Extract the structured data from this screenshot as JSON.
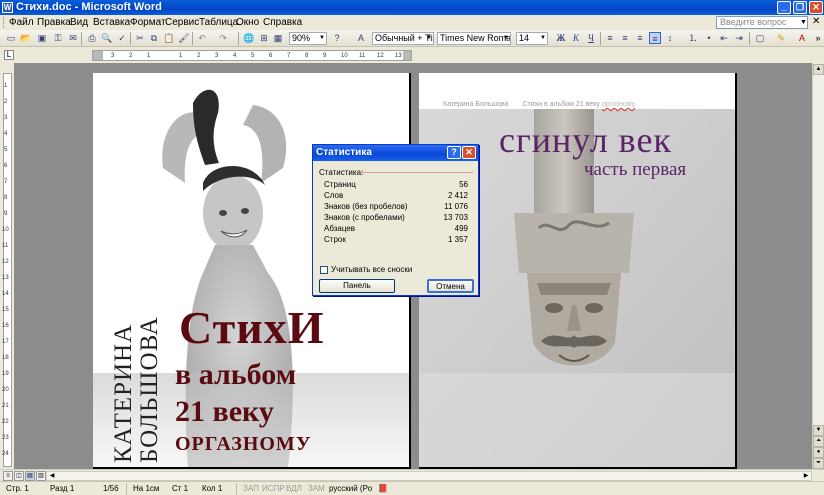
{
  "window": {
    "title": "Стихи.doc - Microsoft Word"
  },
  "menu": {
    "items": [
      "Файл",
      "Правка",
      "Вид",
      "Вставка",
      "Формат",
      "Сервис",
      "Таблица",
      "Окно",
      "Справка"
    ],
    "help_placeholder": "Введите вопрос"
  },
  "toolbar": {
    "zoom": "90%",
    "style": "Обычный + Tim",
    "font": "Times New Roman",
    "size": "14"
  },
  "ruler": {
    "h_numbers": [
      "3",
      "2",
      "1",
      "1",
      "2",
      "3",
      "4",
      "5",
      "6",
      "7",
      "8",
      "9",
      "10",
      "11",
      "12",
      "13"
    ],
    "v_numbers": [
      "1",
      "2",
      "3",
      "4",
      "5",
      "6",
      "7",
      "8",
      "9",
      "10",
      "11",
      "12",
      "13",
      "14",
      "15",
      "16",
      "17",
      "18",
      "19",
      "20",
      "21",
      "22",
      "23",
      "24"
    ]
  },
  "left_page": {
    "title_line1": "СтихИ",
    "title_line2": "в альбом",
    "title_line3": "21 веку",
    "title_line4": "ОРГАЗНОМУ",
    "author_line1": "КАТЕРИНА",
    "author_line2": "БОЛЬШОВА"
  },
  "right_page": {
    "header_author": "Катерина Большова",
    "header_title_start": "Стихи в альбом 21 веку ",
    "header_title_end": "оргазному",
    "title": "сгинул век",
    "subtitle": "часть первая"
  },
  "dialog": {
    "title": "Статистика",
    "group_label": "Статистика:",
    "rows": [
      {
        "label": "Страниц",
        "value": "56"
      },
      {
        "label": "Слов",
        "value": "2 412"
      },
      {
        "label": "Знаков (без пробелов)",
        "value": "11 076"
      },
      {
        "label": "Знаков (с пробелами)",
        "value": "13 703"
      },
      {
        "label": "Абзацев",
        "value": "499"
      },
      {
        "label": "Строк",
        "value": "1 357"
      }
    ],
    "checkbox_label": "Учитывать все сноски",
    "panel_button": "Панель",
    "cancel_button": "Отмена"
  },
  "status": {
    "page": "Стр. 1",
    "section": "Разд 1",
    "pages": "1/56",
    "at": "На 1см",
    "line": "Ст 1",
    "col": "Кол 1",
    "rec": "ЗАП",
    "trk": "ИСПР",
    "ext": "ВДЛ",
    "ovr": "ЗАМ",
    "lang": "русский (Ро"
  },
  "colors": {
    "title_red": "#5a0a10",
    "right_title_purple": "#5b2466",
    "xp_blue": "#0a49d9"
  }
}
